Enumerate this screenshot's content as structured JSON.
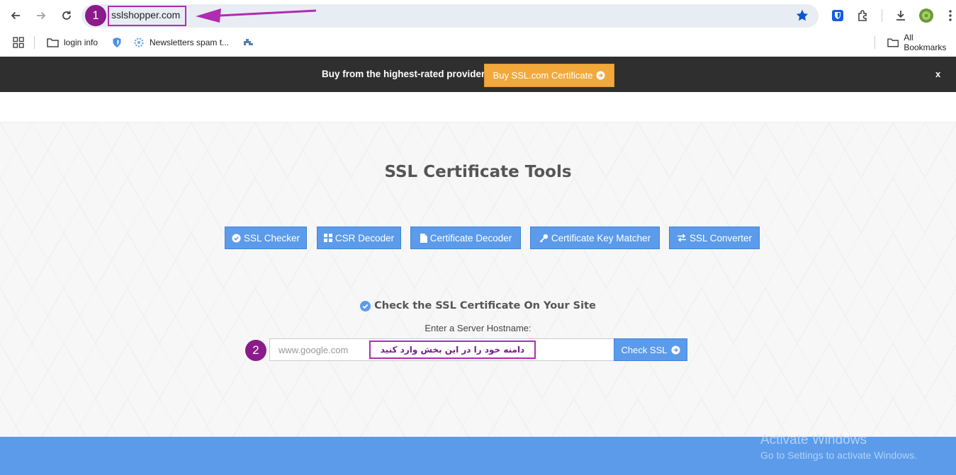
{
  "browser": {
    "url": "sslshopper.com",
    "bookmarks": [
      {
        "label": "login info",
        "icon": "folder-icon"
      },
      {
        "label": "",
        "icon": "shield-icon"
      },
      {
        "label": "Newsletters spam t...",
        "icon": "gear-icon"
      },
      {
        "label": "",
        "icon": "puzzle-icon"
      }
    ],
    "all_bookmarks_label": "All Bookmarks"
  },
  "banner": {
    "text": "Buy from the highest-rated provider",
    "button_label": "Buy SSL.com Certificate",
    "close_label": "x"
  },
  "page": {
    "title": "SSL Certificate Tools",
    "tools": [
      {
        "label": "SSL Checker",
        "icon": "check-circle-icon"
      },
      {
        "label": "CSR Decoder",
        "icon": "grid-icon"
      },
      {
        "label": "Certificate Decoder",
        "icon": "file-icon"
      },
      {
        "label": "Certificate Key Matcher",
        "icon": "key-icon"
      },
      {
        "label": "SSL Converter",
        "icon": "exchange-icon"
      }
    ],
    "check_heading": "Check the SSL Certificate On Your Site",
    "hostname_label": "Enter a Server Hostname:",
    "hostname_placeholder": "www.google.com",
    "check_button_label": "Check SSL"
  },
  "annotations": {
    "badge_1": "1",
    "badge_2": "2",
    "note_fa": "دامنه خود را در این بخش وارد کنید"
  },
  "watermark": {
    "line1": "Activate Windows",
    "line2": "Go to Settings to activate Windows."
  },
  "colors": {
    "accent_blue": "#5b9bea",
    "banner_dark": "#2f2f2f",
    "banner_button": "#f2a93b",
    "annotation_purple": "#8b1a8b"
  }
}
